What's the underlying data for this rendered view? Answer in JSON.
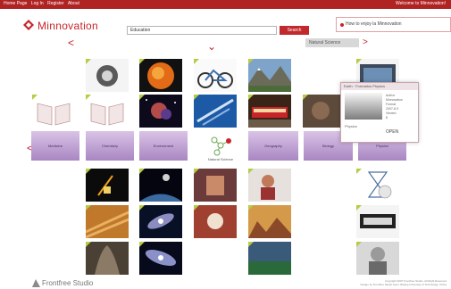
{
  "topbar": {
    "links": [
      "Home Page",
      "Log In",
      "Register",
      "About"
    ],
    "welcome": "Welcome to Minnovation!"
  },
  "brand": {
    "name": "Minnovation"
  },
  "search": {
    "value": "Education",
    "button_label": "Search"
  },
  "help": {
    "text": "How to enjoy la Minnovation"
  },
  "category_tab": {
    "label": "Natural Science"
  },
  "categories": [
    "Medicine",
    "Chemistry",
    "Environment",
    "Geography",
    "Biology",
    "Physics"
  ],
  "molecule_caption": "Natural Science",
  "popup": {
    "title": "Earth · Formation Physics",
    "info": "Author\nMinnovation\nFormat\n2007-8-9\nViewed\n8",
    "name": "Physics",
    "open_label": "OPEN"
  },
  "footer": {
    "studio": "Frontfree Studio",
    "copyright": "Copyright 2007 Frontfree Studio. All Right Reserved",
    "credit": "Design by Frontfree Studio team, Beijing University of Technology, China"
  },
  "colors": {
    "brand_red": "#c8242a",
    "topbar": "#b02323",
    "category_purple": "#b08fcc",
    "corner_green": "#b5cc44"
  }
}
